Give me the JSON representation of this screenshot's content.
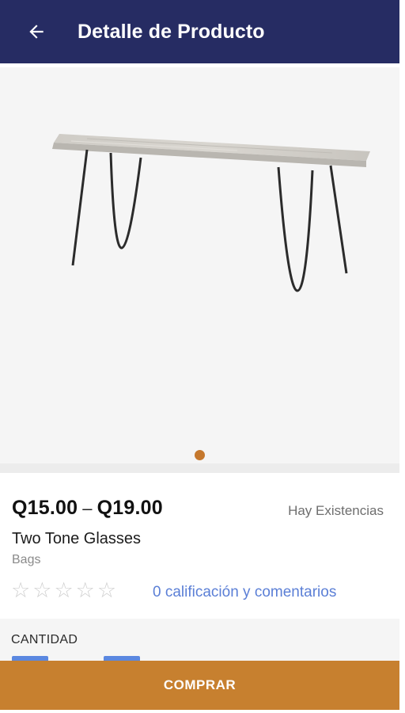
{
  "header": {
    "title": "Detalle de Producto",
    "back_icon": "arrow-left-icon"
  },
  "gallery": {
    "image_subject": "product-table-image",
    "page_count": 1,
    "current_page": 1,
    "dot_color": "#c5782d"
  },
  "product": {
    "price_min": "Q15.00",
    "price_sep": "–",
    "price_max": "Q19.00",
    "stock_status": "Hay Existencias",
    "name": "Two Tone Glasses",
    "category": "Bags",
    "rating": 0,
    "rating_max": 5,
    "reviews_link": "0 calificación y comentarios"
  },
  "quantity": {
    "label": "CANTIDAD"
  },
  "actions": {
    "buy_label": "COMPRAR"
  },
  "colors": {
    "appbar": "#262c63",
    "accent": "#c7802f",
    "link": "#5b7fd6"
  }
}
